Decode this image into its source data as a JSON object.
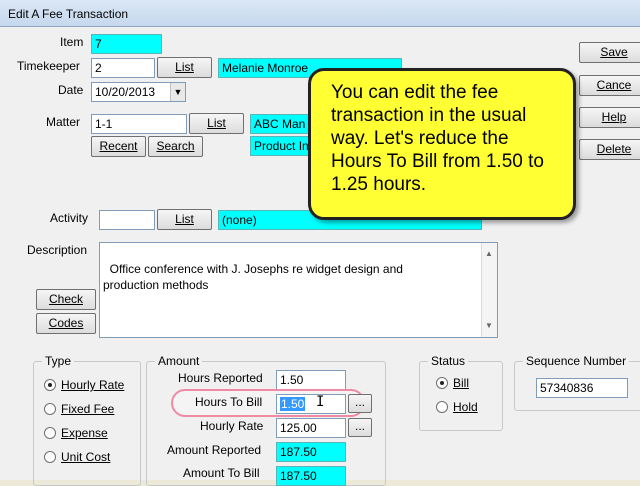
{
  "window": {
    "title": "Edit A Fee Transaction"
  },
  "form": {
    "item_label": "Item",
    "item_value": "7",
    "timekeeper_label": "Timekeeper",
    "timekeeper_value": "2",
    "timekeeper_name": "Melanie Monroe",
    "date_label": "Date",
    "date_value": "10/20/2013",
    "matter_label": "Matter",
    "matter_value": "1-1",
    "matter_client": "ABC Man",
    "matter_desc": "Product In",
    "activity_label": "Activity",
    "activity_value": "",
    "activity_desc": "(none)",
    "description_label": "Description",
    "description_value": "Office conference with J. Josephs re widget design and\nproduction methods"
  },
  "buttons": {
    "list": "List",
    "recent": "Recent",
    "search": "Search",
    "check": "Check",
    "codes": "Codes",
    "save": "Save",
    "cancel": "Cance",
    "help": "Help",
    "delete": "Delete",
    "ellipsis": "..."
  },
  "type_group": {
    "legend": "Type",
    "options": [
      "Hourly Rate",
      "Fixed Fee",
      "Expense",
      "Unit Cost"
    ],
    "selected": "Hourly Rate"
  },
  "amount_group": {
    "legend": "Amount",
    "hours_reported_label": "Hours Reported",
    "hours_reported_value": "1.50",
    "hours_to_bill_label": "Hours To Bill",
    "hours_to_bill_value": "1.50",
    "hourly_rate_label": "Hourly Rate",
    "hourly_rate_value": "125.00",
    "amount_reported_label": "Amount Reported",
    "amount_reported_value": "187.50",
    "amount_to_bill_label": "Amount To Bill",
    "amount_to_bill_value": "187.50"
  },
  "status_group": {
    "legend": "Status",
    "options": [
      "Bill",
      "Hold"
    ],
    "selected": "Bill"
  },
  "sequence_group": {
    "legend": "Sequence Number",
    "value": "57340836"
  },
  "callout": {
    "text": "You can edit the fee transaction in the usual way. Let's reduce the Hours To Bill from 1.50 to 1.25 hours."
  },
  "colors": {
    "highlight_field": "#00ffff",
    "callout": "#ffff33",
    "highlight_ring": "#f08aa4",
    "selection": "#3399ff"
  }
}
